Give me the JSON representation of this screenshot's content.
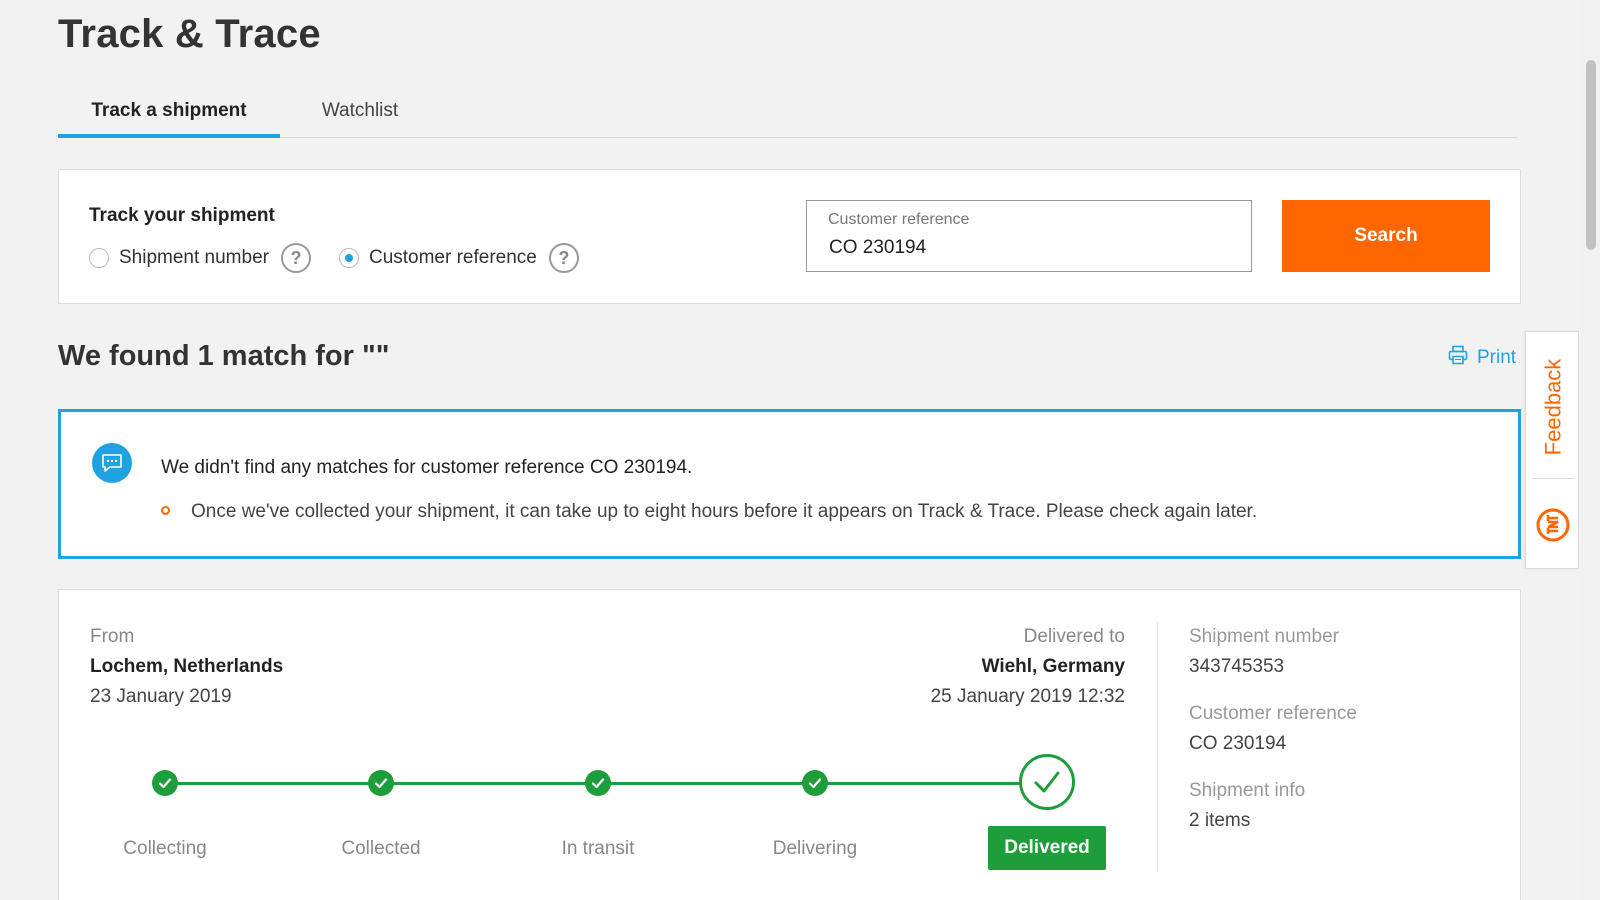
{
  "page": {
    "title": "Track & Trace"
  },
  "tabs": [
    {
      "label": "Track a shipment",
      "active": true
    },
    {
      "label": "Watchlist",
      "active": false
    }
  ],
  "search": {
    "heading": "Track your shipment",
    "options": [
      {
        "label": "Shipment number",
        "selected": false
      },
      {
        "label": "Customer reference",
        "selected": true
      }
    ],
    "help_glyph": "?",
    "field_label": "Customer reference",
    "field_value": "CO 230194",
    "button_label": "Search"
  },
  "results": {
    "heading": "We found 1 match for \"\"",
    "print_label": "Print"
  },
  "notice": {
    "title": "We didn't find any matches for customer reference CO 230194.",
    "bullet": "Once we've collected your shipment, it can take up to eight hours before it appears on Track & Trace. Please check again later."
  },
  "shipment": {
    "from_label": "From",
    "from_city": "Lochem, Netherlands",
    "from_date": "23 January 2019",
    "to_label": "Delivered to",
    "to_city": "Wiehl, Germany",
    "to_date": "25 January 2019 12:32",
    "steps": [
      {
        "label": "Collecting",
        "done": true
      },
      {
        "label": "Collected",
        "done": true
      },
      {
        "label": "In transit",
        "done": true
      },
      {
        "label": "Delivering",
        "done": true
      },
      {
        "label": "Delivered",
        "done": true,
        "current": true
      }
    ],
    "meta": [
      {
        "label": "Shipment number",
        "value": "343745353"
      },
      {
        "label": "Customer reference",
        "value": "CO 230194"
      },
      {
        "label": "Shipment info",
        "value": "2 items"
      }
    ]
  },
  "feedback": {
    "label": "Feedback"
  },
  "colors": {
    "accent_blue": "#1fa3e0",
    "brand_orange": "#ff6600",
    "success_green": "#1e9e3a"
  },
  "icons": [
    "help-icon",
    "print-icon",
    "chat-icon",
    "check-icon",
    "tnt-logo"
  ]
}
